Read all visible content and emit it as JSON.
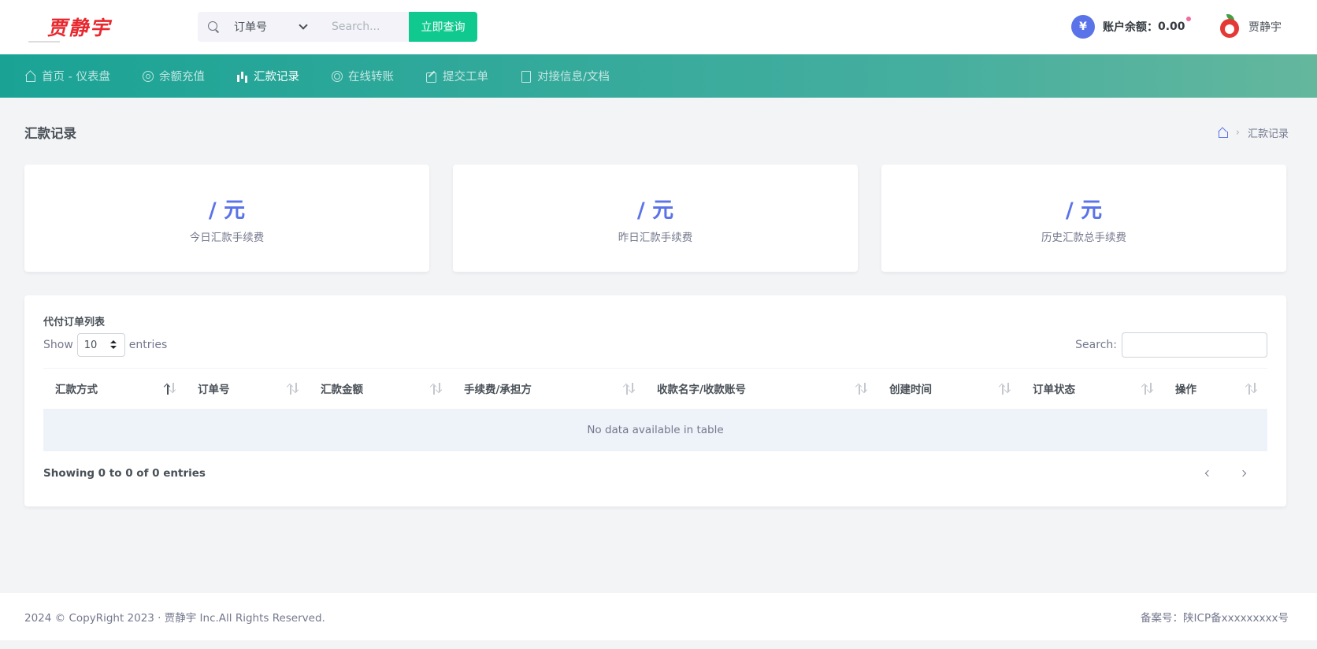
{
  "header": {
    "logo_text": "贾静宇",
    "search": {
      "select_value": "订单号",
      "placeholder": "Search...",
      "button_label": "立即查询"
    },
    "balance": {
      "icon_glyph": "¥",
      "label": "账户余额：",
      "value": "0.00"
    },
    "user": {
      "name": "贾静宇"
    }
  },
  "nav": {
    "items": [
      {
        "label": "首页 - 仪表盘",
        "icon": "home-icon",
        "active": false
      },
      {
        "label": "余额充值",
        "icon": "circle-icon",
        "active": false
      },
      {
        "label": "汇款记录",
        "icon": "bar-chart-icon",
        "active": true
      },
      {
        "label": "在线转账",
        "icon": "lifebuoy-icon",
        "active": false
      },
      {
        "label": "提交工单",
        "icon": "edit-icon",
        "active": false
      },
      {
        "label": "对接信息/文档",
        "icon": "book-icon",
        "active": false
      }
    ]
  },
  "page": {
    "title": "汇款记录",
    "breadcrumb_current": "汇款记录"
  },
  "stats": [
    {
      "value": "/ 元",
      "label": "今日汇款手续费"
    },
    {
      "value": "/ 元",
      "label": "昨日汇款手续费"
    },
    {
      "value": "/ 元",
      "label": "历史汇款总手续费"
    }
  ],
  "table": {
    "title": "代付订单列表",
    "show_label": "Show",
    "length_value": "10",
    "entries_label": "entries",
    "search_label": "Search:",
    "columns": [
      "汇款方式",
      "订单号",
      "汇款金额",
      "手续费/承担方",
      "收款名字/收款账号",
      "创建时间",
      "订单状态",
      "操作"
    ],
    "empty_text": "No data available in table",
    "info_text": "Showing 0 to 0 of 0 entries"
  },
  "footer": {
    "copyright": "2024 © CopyRight 2023 · 贾静宇 Inc.All Rights Reserved.",
    "icp": "备案号：陕ICP备xxxxxxxxx号"
  },
  "colors": {
    "accent": "#5b73e8",
    "nav_start": "#1aa395",
    "search_button": "#10c98f",
    "logo": "#e8272e"
  }
}
